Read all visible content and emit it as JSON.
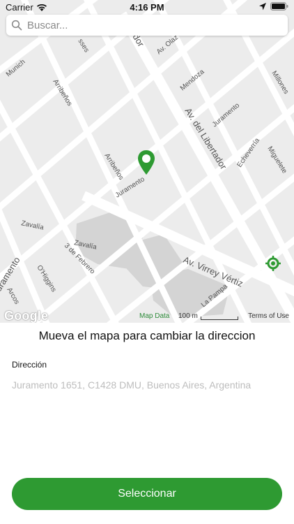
{
  "status_bar": {
    "carrier": "Carrier",
    "time": "4:16 PM",
    "icons": [
      "wifi-icon",
      "location-arrow-icon",
      "battery-icon"
    ]
  },
  "search": {
    "placeholder": "Buscar...",
    "value": "",
    "icon": "search-icon"
  },
  "map": {
    "streets": [
      "Av. del Libertador",
      "Av. Virrey Vértiz",
      "Juramento",
      "Juramento",
      "Mendoza",
      "Echeverría",
      "Miguelete",
      "Millones",
      "Arribeños",
      "Arribeños",
      "Zavalía",
      "Zavalía",
      "3 de Febrero",
      "O'Higgins",
      "Arcos",
      "La Pampa",
      "Munich",
      "Av. Olaz",
      "dor",
      "uramento",
      "sses"
    ],
    "pin_icon": "map-pin-icon",
    "location_icon": "my-location-icon",
    "google_logo": "Google",
    "map_data": "Map Data",
    "scale_label": "100 m",
    "terms": "Terms of Use"
  },
  "instruction": "Mueva el mapa para cambiar la direccion",
  "address": {
    "label": "Dirección",
    "value": "Juramento 1651, C1428 DMU, Buenos Aires, Argentina"
  },
  "select_button": "Seleccionar",
  "colors": {
    "accent": "#2e9a32",
    "map_background": "#ececec",
    "road": "#ffffff",
    "park": "#d6d6d6"
  }
}
